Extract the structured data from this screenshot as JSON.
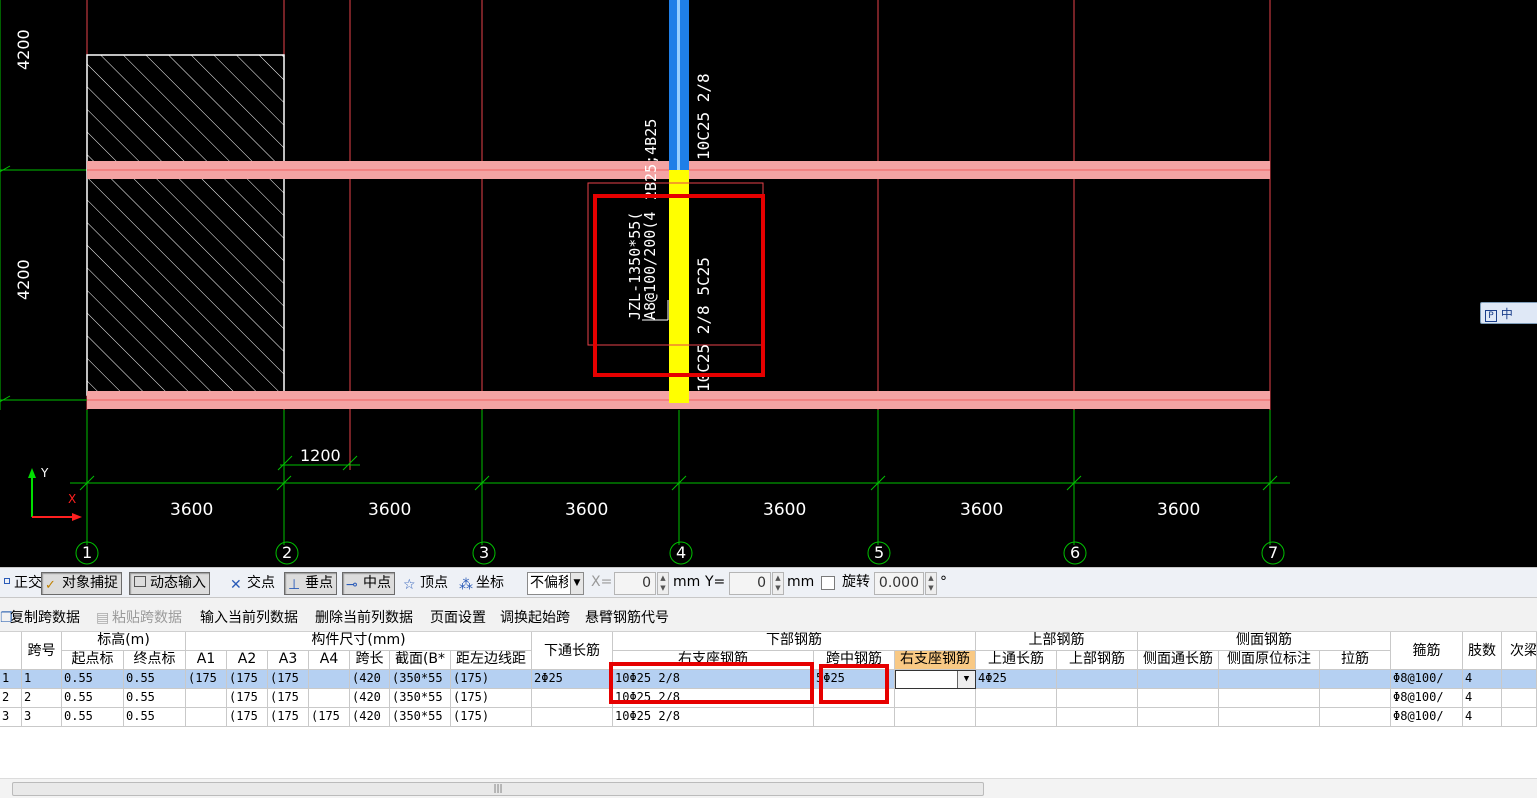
{
  "cad": {
    "dims_vertical": [
      "4200",
      "4200"
    ],
    "dim_horizontal_small": "1200",
    "dims_horizontal": [
      "3600",
      "3600",
      "3600",
      "3600",
      "3600",
      "3600"
    ],
    "axis_numbers": [
      "1",
      "2",
      "3",
      "4",
      "5",
      "6",
      "7"
    ],
    "beam_label_1": "JZL-1350*55(",
    "beam_label_2": "A8@100/200(4",
    "beam_label_3": "2B25;4B25",
    "upper_rebar_text": "10C25 2/8",
    "lower_rebar_text": "10C25 2/8 5C25",
    "ucs_y": "Y",
    "ucs_x": "X",
    "ime_text": "中"
  },
  "snapbar": {
    "ortho": "正交",
    "object_snap": "对象捕捉",
    "dynamic_input": "动态输入",
    "intersection": "交点",
    "perpendicular": "垂点",
    "midpoint": "中点",
    "vertex": "顶点",
    "coordinate": "坐标",
    "offset_mode": "不偏移",
    "x_label": "X=",
    "x_value": "0",
    "x_unit": "mm",
    "y_label": "Y=",
    "y_value": "0",
    "y_unit": "mm",
    "rotate_label": "旋转",
    "rotate_value": "0.000",
    "degree": "°"
  },
  "table_toolbar": {
    "copy_span": "复制跨数据",
    "paste_span": "粘贴跨数据",
    "input_column": "输入当前列数据",
    "delete_column": "删除当前列数据",
    "page_setup": "页面设置",
    "adjust_start_span": "调换起始跨",
    "cantilever_code": "悬臂钢筋代号"
  },
  "grid": {
    "headers": {
      "span_no": "跨号",
      "elevation": "标高(m)",
      "start_elev": "起点标",
      "end_elev": "终点标",
      "dims": "构件尺寸(mm)",
      "a1": "A1",
      "a2": "A2",
      "a3": "A3",
      "a4": "A4",
      "span_len": "跨长",
      "section": "截面(B*",
      "dist_left": "距左边线距",
      "bottom_through": "下通长筋",
      "bottom_rebar": "下部钢筋",
      "right_support": "右支座钢筋",
      "mid_span": "跨中钢筋",
      "right_support2": "右支座钢筋",
      "top_rebar": "上部钢筋",
      "top_through": "上通长筋",
      "top_rebar2": "上部钢筋",
      "side_rebar": "侧面钢筋",
      "side_through": "侧面通长筋",
      "side_local": "侧面原位标注",
      "tie": "拉筋",
      "stirrup": "箍筋",
      "legs": "肢数",
      "secondary": "次梁"
    },
    "rows": [
      {
        "idx": "1",
        "span": "1",
        "start": "0.55",
        "end": "0.55",
        "a1": "(175",
        "a2": "(175",
        "a3": "(175",
        "a4": "",
        "len": "(420",
        "sec": "(350*55",
        "dist": "(175)",
        "bthrough": "2Φ25",
        "rsup": "10Φ25 2/8",
        "mid": "5Φ25",
        "rsup2": "",
        "tthrough": "4Φ25",
        "trebar": "",
        "sthrough": "",
        "slocal": "",
        "tie": "",
        "stirrup": "Φ8@100/",
        "legs": "4"
      },
      {
        "idx": "2",
        "span": "2",
        "start": "0.55",
        "end": "0.55",
        "a1": "",
        "a2": "(175",
        "a3": "(175",
        "a4": "",
        "len": "(420",
        "sec": "(350*55",
        "dist": "(175)",
        "bthrough": "",
        "rsup": "10Φ25 2/8",
        "mid": "",
        "rsup2": "",
        "tthrough": "",
        "trebar": "",
        "sthrough": "",
        "slocal": "",
        "tie": "",
        "stirrup": "Φ8@100/",
        "legs": "4"
      },
      {
        "idx": "3",
        "span": "3",
        "start": "0.55",
        "end": "0.55",
        "a1": "",
        "a2": "(175",
        "a3": "(175",
        "a4": "(175",
        "len": "(420",
        "sec": "(350*55",
        "dist": "(175)",
        "bthrough": "",
        "rsup": "10Φ25 2/8",
        "mid": "",
        "rsup2": "",
        "tthrough": "",
        "trebar": "",
        "sthrough": "",
        "slocal": "",
        "tie": "",
        "stirrup": "Φ8@100/",
        "legs": "4"
      }
    ]
  },
  "colors": {
    "cad_background": "#000000",
    "grid_line": "#e8424a",
    "axis_line": "#00c000",
    "beam_fill": "#f4a3a3",
    "column_blue": "#1f7fe8",
    "column_yellow": "#ffff00",
    "highlight_red": "#e60000",
    "selected_row": "#b5d0f2",
    "active_header": "#f9c984"
  }
}
